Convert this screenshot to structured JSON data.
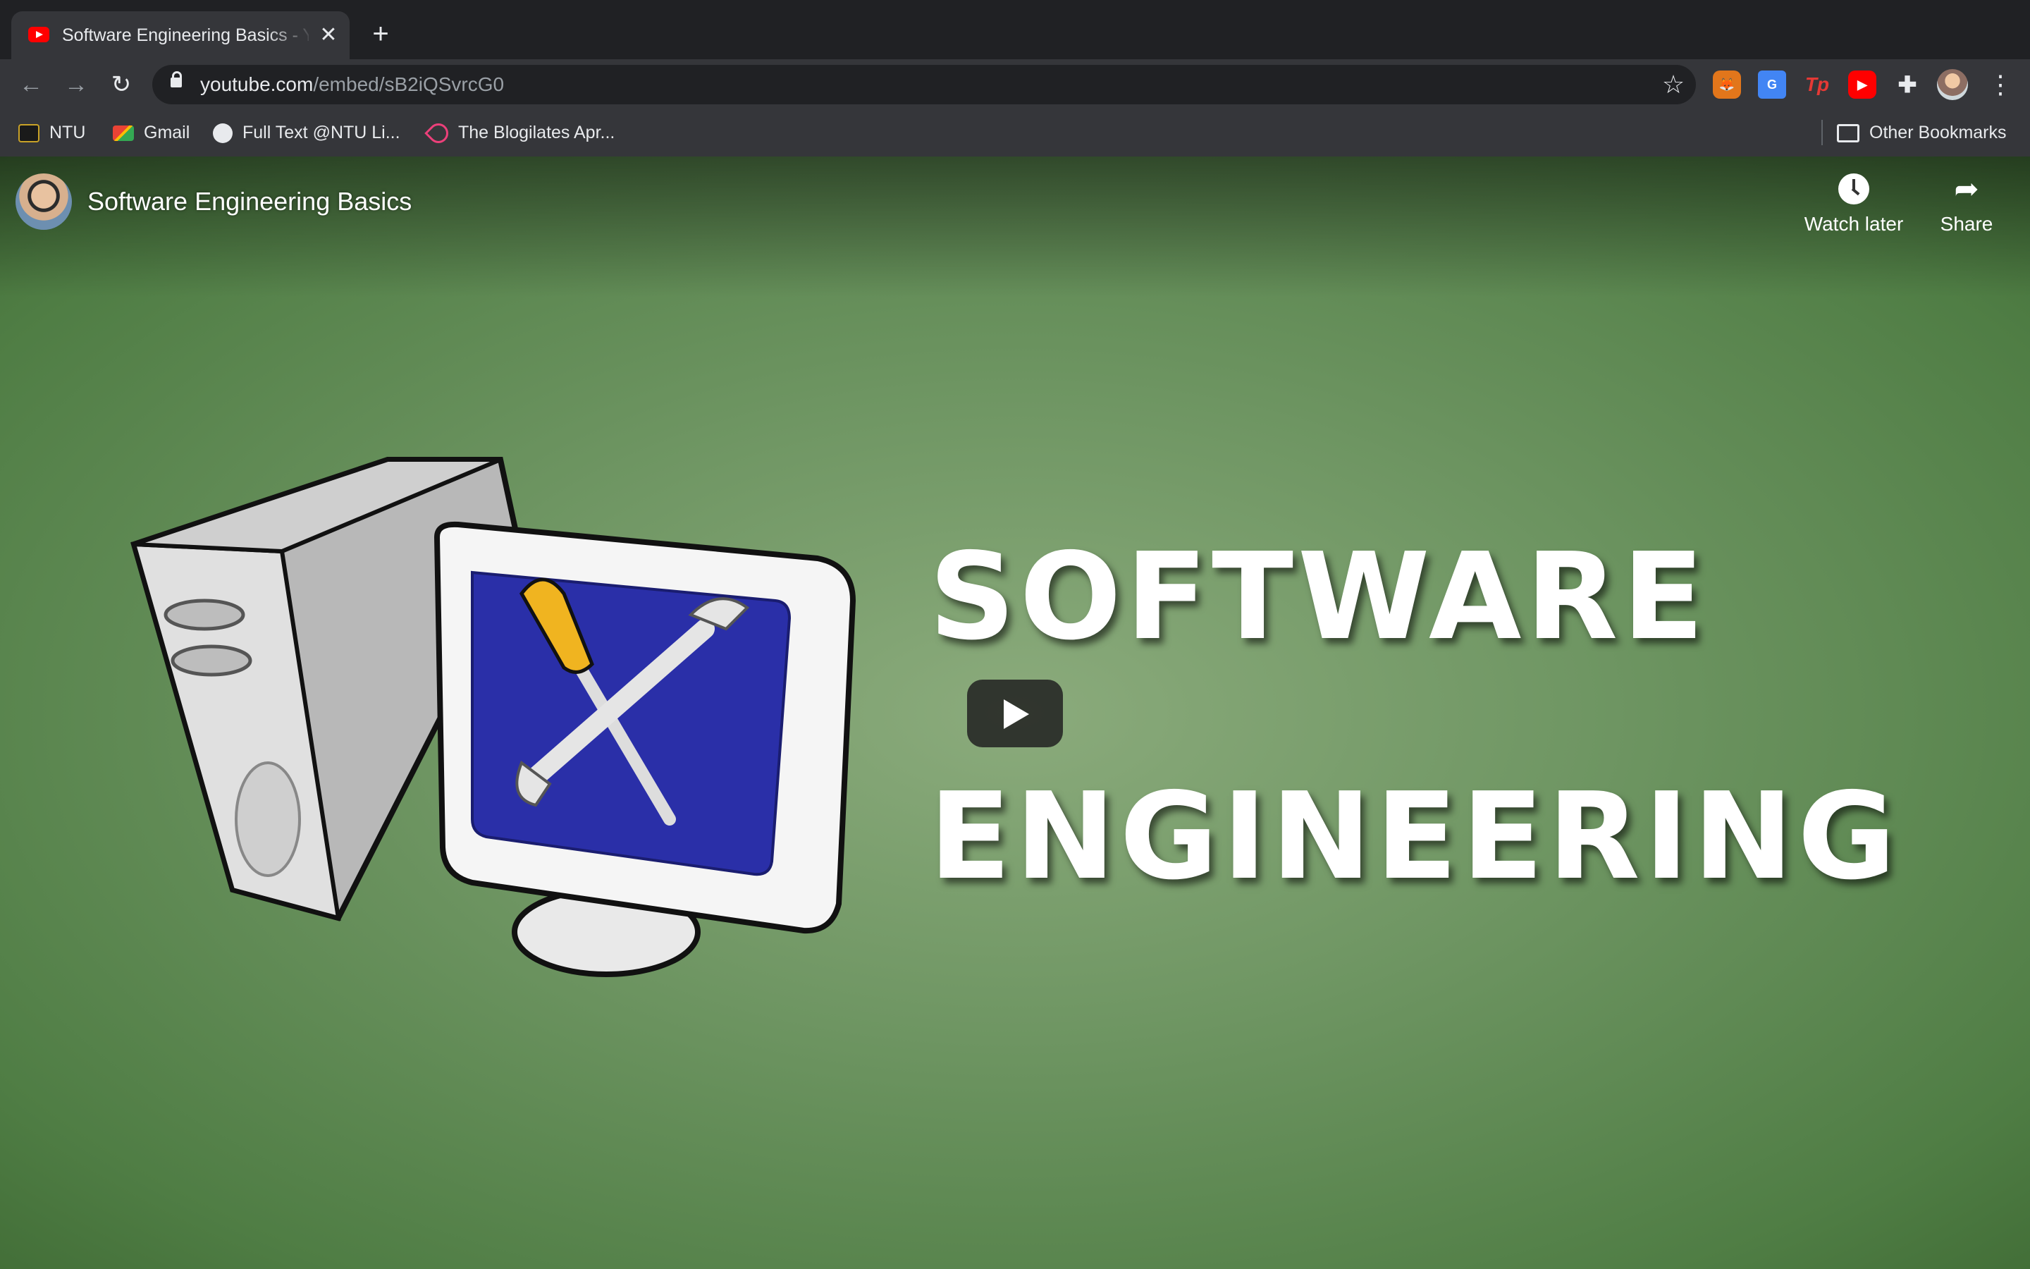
{
  "browser": {
    "tab": {
      "title": "Software Engineering Basics - YouTube",
      "close_glyph": "✕",
      "favicon": "youtube-icon"
    },
    "new_tab_glyph": "+",
    "nav": {
      "back_glyph": "←",
      "forward_glyph": "→",
      "reload_glyph": "↻"
    },
    "url": {
      "host": "youtube.com",
      "path": "/embed/sB2iQSvrcG0"
    },
    "star_glyph": "☆",
    "extensions": {
      "fox_glyph": "🦊",
      "translate_glyph": "G",
      "tp_glyph": "Tp",
      "yt_glyph": "▶",
      "puzzle_glyph": "✚"
    },
    "menu_glyph": "⋮"
  },
  "bookmarks": {
    "items": [
      {
        "label": "NTU",
        "icon": "blackboard-icon"
      },
      {
        "label": "Gmail",
        "icon": "gmail-icon"
      },
      {
        "label": "Full Text @NTU Li...",
        "icon": "globe-icon"
      },
      {
        "label": "The Blogilates Apr...",
        "icon": "blogilates-icon"
      }
    ],
    "other": {
      "label": "Other Bookmarks",
      "icon": "folder-icon"
    }
  },
  "player": {
    "video_title": "Software Engineering Basics",
    "actions": {
      "watch_later": "Watch later",
      "share": "Share",
      "share_glyph": "➦"
    },
    "thumbnail": {
      "line1": "Software",
      "line2": "Engineering"
    },
    "colors": {
      "background": "#6f9663",
      "screen_blue": "#2a2fa8",
      "play_button": "#212121"
    }
  }
}
